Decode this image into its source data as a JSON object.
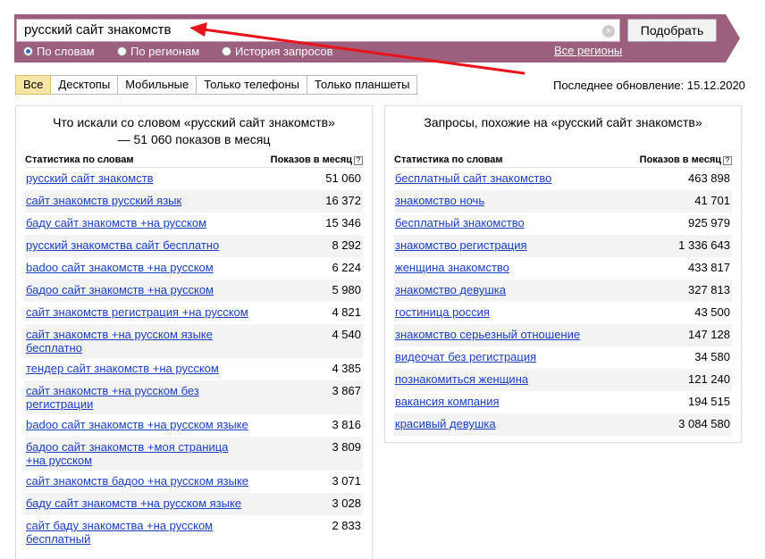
{
  "search": {
    "query": "русский сайт знакомств",
    "submit_label": "Подобрать",
    "all_regions_label": "Все регионы",
    "modes": [
      {
        "label": "По словам",
        "selected": true
      },
      {
        "label": "По регионам",
        "selected": false
      },
      {
        "label": "История запросов",
        "selected": false
      }
    ]
  },
  "device_tabs": [
    {
      "label": "Все",
      "active": true
    },
    {
      "label": "Десктопы",
      "active": false
    },
    {
      "label": "Мобильные",
      "active": false
    },
    {
      "label": "Только телефоны",
      "active": false
    },
    {
      "label": "Только планшеты",
      "active": false
    }
  ],
  "last_update": "Последнее обновление: 15.12.2020",
  "left_panel": {
    "title": "Что искали со словом «русский сайт знакомств» — 51 060 показов в месяц",
    "col_query": "Статистика по словам",
    "col_count": "Показов в месяц",
    "rows": [
      {
        "query": "русский сайт знакомств",
        "count": "51 060"
      },
      {
        "query": "сайт знакомств русский язык",
        "count": "16 372"
      },
      {
        "query": "баду сайт знакомств +на русском",
        "count": "15 346"
      },
      {
        "query": "русский знакомства сайт бесплатно",
        "count": "8 292"
      },
      {
        "query": "badoo сайт знакомств +на русском",
        "count": "6 224"
      },
      {
        "query": "бадоо сайт знакомств +на русском",
        "count": "5 980"
      },
      {
        "query": "сайт знакомств регистрация +на русском",
        "count": "4 821"
      },
      {
        "query": "сайт знакомств +на русском языке бесплатно",
        "count": "4 540"
      },
      {
        "query": "тендер сайт знакомств +на русском",
        "count": "4 385"
      },
      {
        "query": "сайт знакомств +на русском без регистрации",
        "count": "3 867"
      },
      {
        "query": "badoo сайт знакомств +на русском языке",
        "count": "3 816"
      },
      {
        "query": "бадоо сайт знакомств +моя страница +на русском",
        "count": "3 809"
      },
      {
        "query": "сайт знакомств бадоо +на русском языке",
        "count": "3 071"
      },
      {
        "query": "баду сайт знакомств +на русском языке",
        "count": "3 028"
      },
      {
        "query": "сайт баду знакомства +на русском бесплатный",
        "count": "2 833"
      }
    ]
  },
  "right_panel": {
    "title": "Запросы, похожие на «русский сайт знакомств»",
    "col_query": "Статистика по словам",
    "col_count": "Показов в месяц",
    "rows": [
      {
        "query": "бесплатный сайт знакомство",
        "count": "463 898"
      },
      {
        "query": "знакомство ночь",
        "count": "41 701"
      },
      {
        "query": "бесплатный знакомство",
        "count": "925 979"
      },
      {
        "query": "знакомство регистрация",
        "count": "1 336 643"
      },
      {
        "query": "женщина знакомство",
        "count": "433 817"
      },
      {
        "query": "знакомство девушка",
        "count": "327 813"
      },
      {
        "query": "гостиница россия",
        "count": "43 500"
      },
      {
        "query": "знакомство серьезный отношение",
        "count": "147 128"
      },
      {
        "query": "видеочат без регистрация",
        "count": "34 580"
      },
      {
        "query": "познакомиться женщина",
        "count": "121 240"
      },
      {
        "query": "вакансия компания",
        "count": "194 515"
      },
      {
        "query": "красивый девушка",
        "count": "3 084 580"
      }
    ]
  },
  "colors": {
    "bar": "#9d5f7e",
    "link": "#1a3dc1",
    "active_tab": "#f5e6a5",
    "annotation_arrow": "#e8141c"
  }
}
